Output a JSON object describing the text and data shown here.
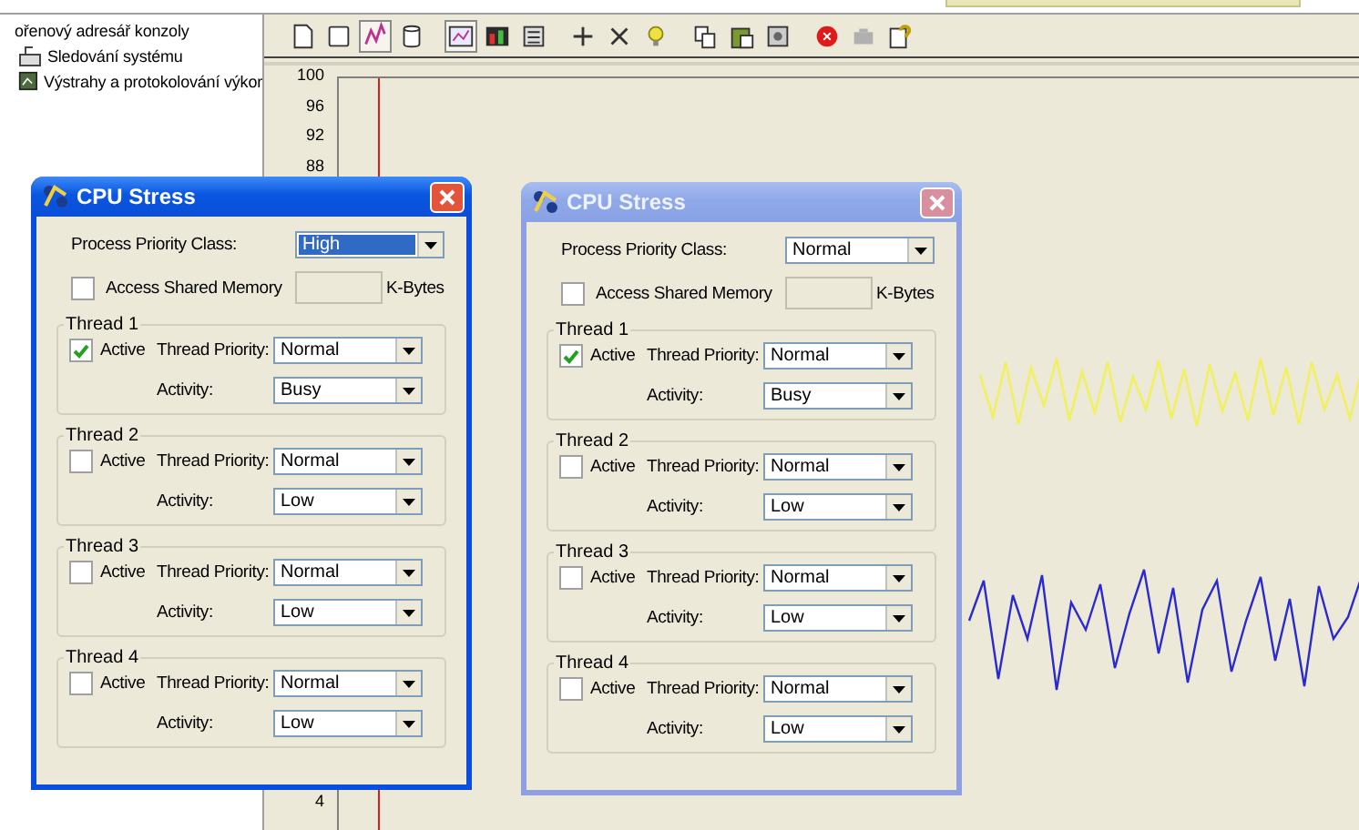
{
  "tree": {
    "items": [
      {
        "label": "ořenový adresář konzoly"
      },
      {
        "label": "Sledování systému"
      },
      {
        "label": "Výstrahy a protokolování výkor"
      }
    ]
  },
  "toolbar": {
    "groups": [
      [
        {
          "pressed": false
        },
        {
          "pressed": false
        },
        {
          "pressed": true
        },
        {
          "pressed": false
        }
      ],
      [
        {
          "pressed": true
        },
        {
          "pressed": false
        },
        {
          "pressed": false
        }
      ],
      [
        {
          "pressed": false
        },
        {
          "pressed": false
        },
        {
          "pressed": false
        }
      ],
      [
        {
          "pressed": false
        },
        {
          "pressed": false
        },
        {
          "pressed": false
        }
      ],
      [
        {
          "pressed": false
        },
        {
          "pressed": false
        },
        {
          "pressed": false
        }
      ]
    ]
  },
  "graph": {
    "y_labels": [
      "100",
      "96",
      "92",
      "88",
      "4"
    ]
  },
  "dialogs": [
    {
      "title": "CPU Stress",
      "active": true,
      "priority_label": "Process Priority Class:",
      "priority": "High",
      "priority_focused": true,
      "shared_memory": {
        "label": "Access Shared Memory",
        "checked": false,
        "unit": "K-Bytes"
      },
      "threads": [
        {
          "label": "Thread 1",
          "active_label": "Active",
          "active": true,
          "priority_label": "Thread Priority:",
          "priority": "Normal",
          "activity_label": "Activity:",
          "activity": "Busy"
        },
        {
          "label": "Thread 2",
          "active_label": "Active",
          "active": false,
          "priority_label": "Thread Priority:",
          "priority": "Normal",
          "activity_label": "Activity:",
          "activity": "Low"
        },
        {
          "label": "Thread 3",
          "active_label": "Active",
          "active": false,
          "priority_label": "Thread Priority:",
          "priority": "Normal",
          "activity_label": "Activity:",
          "activity": "Low"
        },
        {
          "label": "Thread 4",
          "active_label": "Active",
          "active": false,
          "priority_label": "Thread Priority:",
          "priority": "Normal",
          "activity_label": "Activity:",
          "activity": "Low"
        }
      ]
    },
    {
      "title": "CPU Stress",
      "active": false,
      "priority_label": "Process Priority Class:",
      "priority": "Normal",
      "priority_focused": false,
      "shared_memory": {
        "label": "Access Shared Memory",
        "checked": false,
        "unit": "K-Bytes"
      },
      "threads": [
        {
          "label": "Thread 1",
          "active_label": "Active",
          "active": true,
          "priority_label": "Thread Priority:",
          "priority": "Normal",
          "activity_label": "Activity:",
          "activity": "Busy"
        },
        {
          "label": "Thread 2",
          "active_label": "Active",
          "active": false,
          "priority_label": "Thread Priority:",
          "priority": "Normal",
          "activity_label": "Activity:",
          "activity": "Low"
        },
        {
          "label": "Thread 3",
          "active_label": "Active",
          "active": false,
          "priority_label": "Thread Priority:",
          "priority": "Normal",
          "activity_label": "Activity:",
          "activity": "Low"
        },
        {
          "label": "Thread 4",
          "active_label": "Active",
          "active": false,
          "priority_label": "Thread Priority:",
          "priority": "Normal",
          "activity_label": "Activity:",
          "activity": "Low"
        }
      ]
    }
  ]
}
